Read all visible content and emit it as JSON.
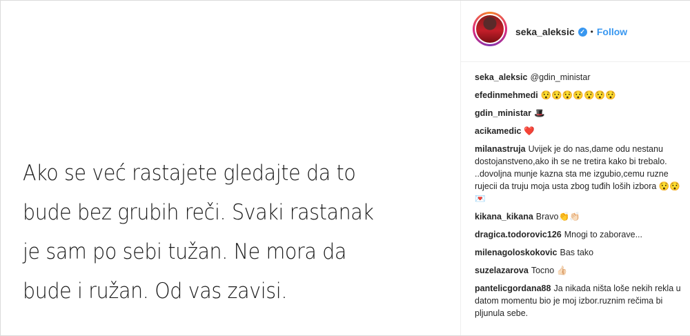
{
  "post": {
    "quote_lines": [
      "Ako se već rastajete gledajte da to",
      "bude bez grubih reči. Svaki rastanak",
      "je sam po sebi tužan. Ne mora da",
      "bude i ružan. Od vas zavisi."
    ]
  },
  "header": {
    "username": "seka_aleksic",
    "separator": "•",
    "follow_label": "Follow",
    "verified_icon": "verified-badge-icon"
  },
  "comments": [
    {
      "user": "seka_aleksic",
      "text": "@gdin_ministar"
    },
    {
      "user": "efedinmehmedi",
      "text": "😯😯😯😯😯😯😯"
    },
    {
      "user": "gdin_ministar",
      "text": "🎩"
    },
    {
      "user": "acikamedic",
      "text": "❤️"
    },
    {
      "user": "milanastruja",
      "text": "Uvijek je do nas,dame odu nestanu dostojanstveno,ako ih se ne tretira kako bi trebalo. ..dovoljna munje kazna sta me izgubio,cemu ruzne rujecii da truju moja usta zbog tuđih loših izbora 😯😯💌"
    },
    {
      "user": "kikana_kikana",
      "text": "Bravo👏👏🏻"
    },
    {
      "user": "dragica.todorovic126",
      "text": "Mnogi to zaborave..."
    },
    {
      "user": "milenagoloskokovic",
      "text": "Bas tako"
    },
    {
      "user": "suzelazarova",
      "text": "Tocno 👍🏻"
    },
    {
      "user": "pantelicgordana88",
      "text": "Ja nikada ništa loše nekih rekla u datom momentu bio je moj izbor.ruznim rečima bi pljunula sebe."
    }
  ]
}
